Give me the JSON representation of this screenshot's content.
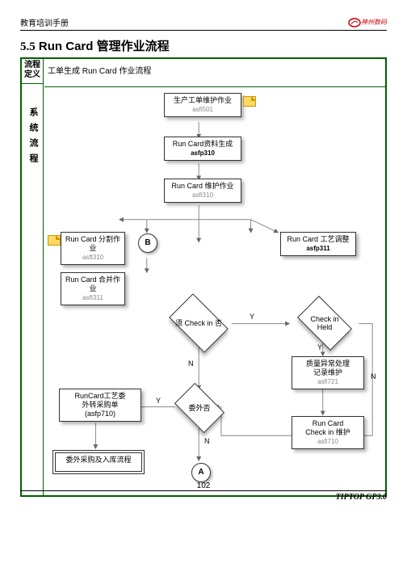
{
  "header": {
    "left": "教育培训手册",
    "logo": "神州数码"
  },
  "section": {
    "num": "5.5",
    "title": "Run Card 管理作业流程"
  },
  "sidebar": {
    "top1": "流程",
    "top2": "定义",
    "label": "系统流程"
  },
  "definition": "工单生成 Run Card 作业流程",
  "nodes": {
    "n1": {
      "t": "生产工单维护作业",
      "c": "asfi501"
    },
    "n2": {
      "t": "Run Card资料生成",
      "c": "asfp310"
    },
    "n3": {
      "t": "Run Card 维护作业",
      "c": "asfi310"
    },
    "n4": {
      "t": "Run Card 分割作业",
      "c": "asft310"
    },
    "n5": {
      "t": "Run Card 合并作业",
      "c": "asft311"
    },
    "n6": {
      "t": "Run Card 工艺调整",
      "c": "asfp311"
    },
    "d1": "须 Check in\n否",
    "d2": "Check in Held",
    "n7": {
      "t": "质量异常处理\n记录维护",
      "c": "asfi721"
    },
    "n8": {
      "t": "RunCard工艺委\n外转采购单",
      "c": "(asfp710)"
    },
    "d3": "委外否",
    "n9": {
      "t": "Run Card\nCheck in 维护",
      "c": "asfi710"
    },
    "n10": "委外采购及入库流程",
    "cA": "A",
    "cB": "B"
  },
  "labels": {
    "Y": "Y",
    "N": "N"
  },
  "footer": {
    "page": "102",
    "right": "TIPTOP GP3.0"
  }
}
